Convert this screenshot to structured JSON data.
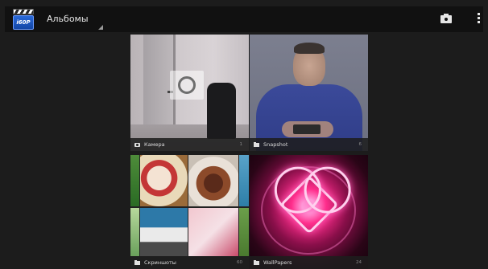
{
  "action_bar": {
    "app_icon_label": "i60P",
    "title": "Альбомы",
    "camera_button_icon": "camera-icon",
    "overflow_icon": "overflow-menu-icon"
  },
  "albums": [
    {
      "label": "Камера",
      "count": "1",
      "icon": "camera-icon"
    },
    {
      "label": "Snapshot",
      "count": "6",
      "icon": "folder-icon"
    },
    {
      "label": "Скриншоты",
      "count": "60",
      "icon": "folder-icon"
    },
    {
      "label": "WallPapers",
      "count": "24",
      "icon": "folder-icon"
    }
  ],
  "colors": {
    "background": "#1c1c1c",
    "action_bar": "#111111",
    "caption_bar": "#1e1e1e",
    "text": "#e8e8e8"
  }
}
